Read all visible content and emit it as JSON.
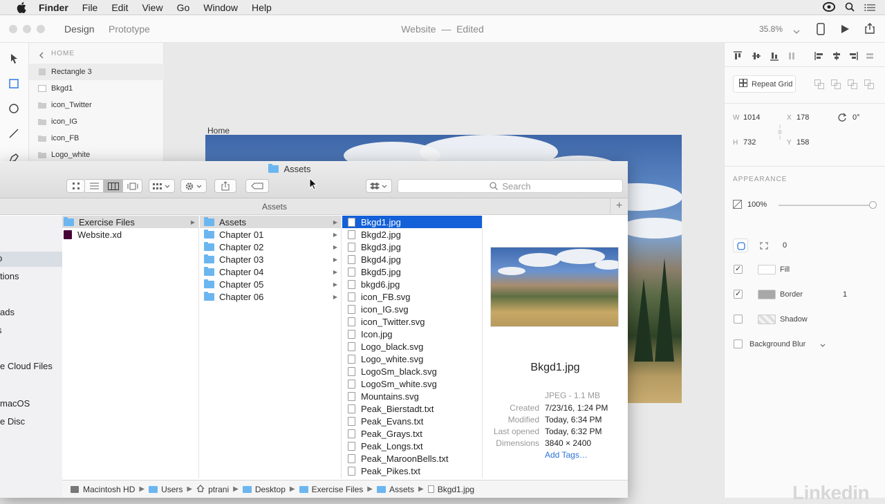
{
  "menubar": {
    "items": [
      "Finder",
      "File",
      "Edit",
      "View",
      "Go",
      "Window",
      "Help"
    ]
  },
  "xd": {
    "tabs": [
      "Design",
      "Prototype"
    ],
    "title": "Website",
    "title_sep": "—",
    "status": "Edited",
    "zoom": "35.8%",
    "layers": {
      "crumb": "HOME",
      "items": [
        "Rectangle 3",
        "Bkgd1",
        "icon_Twitter",
        "icon_IG",
        "icon_FB",
        "Logo_white"
      ]
    },
    "artboard_label": "Home",
    "inspector": {
      "repeat_grid": "Repeat Grid",
      "w_label": "W",
      "w": "1014",
      "h_label": "H",
      "h": "732",
      "x_label": "X",
      "x": "178",
      "y_label": "Y",
      "y": "158",
      "rotation": "0°",
      "appearance": "APPEARANCE",
      "opacity": "100%",
      "opacity_level": 1.0,
      "corner_radius": "0",
      "fill": "Fill",
      "border": "Border",
      "border_width": "1",
      "shadow": "Shadow",
      "background_blur": "Background Blur"
    },
    "watermark": "Linkedin"
  },
  "finder": {
    "title": "Assets",
    "search_placeholder": "Search",
    "path_title": "Assets",
    "sidebar_fragments": [
      "p",
      "tions",
      "ads",
      "s",
      "e Cloud Files",
      "macOS",
      "e Disc"
    ],
    "col1": [
      {
        "name": "Exercise Files",
        "kind": "folder",
        "state": "grey",
        "arrow": true
      },
      {
        "name": "Website.xd",
        "kind": "xd",
        "state": "",
        "arrow": false
      }
    ],
    "col2": [
      {
        "name": "Assets",
        "state": "grey"
      },
      {
        "name": "Chapter 01",
        "state": ""
      },
      {
        "name": "Chapter 02",
        "state": ""
      },
      {
        "name": "Chapter 03",
        "state": ""
      },
      {
        "name": "Chapter 04",
        "state": ""
      },
      {
        "name": "Chapter 05",
        "state": ""
      },
      {
        "name": "Chapter 06",
        "state": ""
      }
    ],
    "col3": [
      "Bkgd1.jpg",
      "Bkgd2.jpg",
      "Bkgd3.jpg",
      "Bkgd4.jpg",
      "Bkgd5.jpg",
      "bkgd6.jpg",
      "icon_FB.svg",
      "icon_IG.svg",
      "icon_Twitter.svg",
      "Icon.jpg",
      "Logo_black.svg",
      "Logo_white.svg",
      "LogoSm_black.svg",
      "LogoSm_white.svg",
      "Mountains.svg",
      "Peak_Bierstadt.txt",
      "Peak_Evans.txt",
      "Peak_Grays.txt",
      "Peak_Longs.txt",
      "Peak_MaroonBells.txt",
      "Peak_Pikes.txt"
    ],
    "preview": {
      "name": "Bkgd1.jpg",
      "kind": "JPEG - 1.1 MB",
      "created_label": "Created",
      "created": "7/23/16, 1:24 PM",
      "modified_label": "Modified",
      "modified": "Today, 6:34 PM",
      "opened_label": "Last opened",
      "opened": "Today, 6:32 PM",
      "dimensions_label": "Dimensions",
      "dimensions": "3840 × 2400",
      "add_tags": "Add Tags…"
    },
    "pathbar": [
      "Macintosh HD",
      "Users",
      "ptrani",
      "Desktop",
      "Exercise Files",
      "Assets",
      "Bkgd1.jpg"
    ]
  },
  "colors": {
    "selection_blue": "#1360d8",
    "folder_blue": "#6cb6f0",
    "link_blue": "#2b72d8"
  }
}
